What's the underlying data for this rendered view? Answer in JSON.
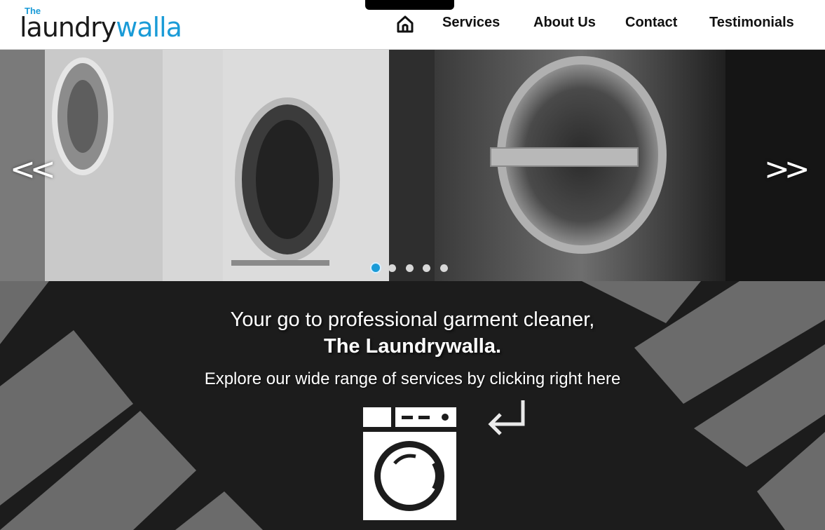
{
  "header": {
    "logo": {
      "small": "The",
      "word_dark": "laundry",
      "word_blue": "walla"
    },
    "nav": {
      "home_icon": "home-icon",
      "items": [
        {
          "label": "Services"
        },
        {
          "label": "About Us"
        },
        {
          "label": "Contact"
        },
        {
          "label": "Testimonials"
        }
      ]
    }
  },
  "slider": {
    "prev_label": "<<",
    "next_label": ">>",
    "dot_count": 5,
    "active_dot": 1
  },
  "hero": {
    "line1": "Your go to professional garment cleaner,",
    "line2": "The Laundrywalla.",
    "subline": "Explore our wide range of services by clicking right here",
    "washer_icon": "washing-machine-icon",
    "enter_icon": "return-arrow-icon"
  },
  "colors": {
    "accent": "#1a9bd7",
    "dark_bg": "#1c1c1c",
    "stripe": "#6e6e6e"
  }
}
